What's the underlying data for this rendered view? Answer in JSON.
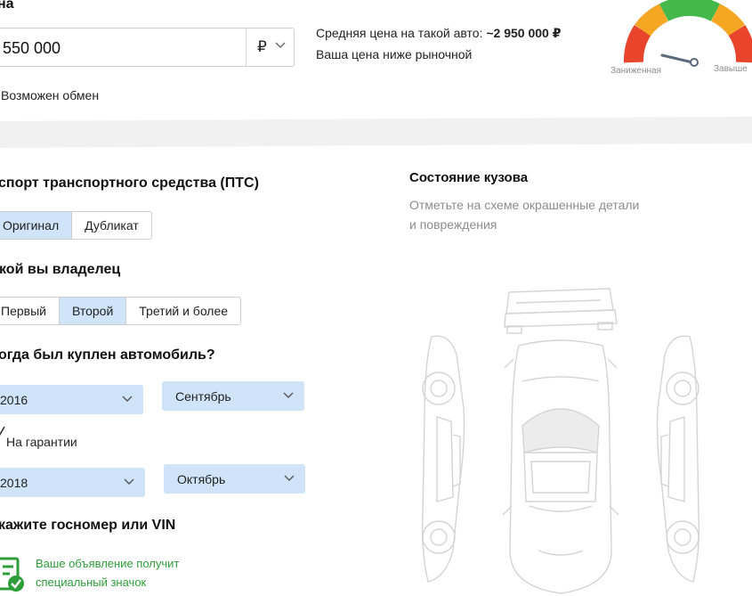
{
  "price": {
    "section_label": "на",
    "value": "550 000",
    "currency": "₽",
    "avg_label": "Средняя цена на такой авто:",
    "avg_value": "~2 950 000 ₽",
    "verdict": "Ваша цена ниже рыночной",
    "gauge_low_label": "Заниженная",
    "gauge_high_label": "Завыше",
    "exchange_label": "Возможен обмен"
  },
  "pts": {
    "title": "спорт транспортного средства (ПТС)",
    "options": [
      "Оригинал",
      "Дубликат"
    ],
    "selected": "Оригинал"
  },
  "owner": {
    "title": "кой вы владелец",
    "options": [
      "Первый",
      "Второй",
      "Третий и более"
    ],
    "selected": "Второй"
  },
  "purchase": {
    "title": "огда был куплен автомобиль?",
    "year": "2016",
    "month": "Сентябрь"
  },
  "warranty": {
    "label": "На гарантии",
    "year": "2018",
    "month": "Октябрь"
  },
  "vin": {
    "title": "кажите госномер или VIN",
    "badge_line1": "Ваше объявление получит",
    "badge_line2": "специальный значок"
  },
  "body_condition": {
    "title": "Состояние кузова",
    "hint_line1": "Отметьте на схеме окрашенные детали",
    "hint_line2": "и повреждения"
  },
  "colors": {
    "accent_blue": "#cfe4f8",
    "success_green": "#2e9e3a",
    "gauge_red": "#e8452c",
    "gauge_orange": "#f5a623",
    "gauge_green": "#44b84b"
  }
}
